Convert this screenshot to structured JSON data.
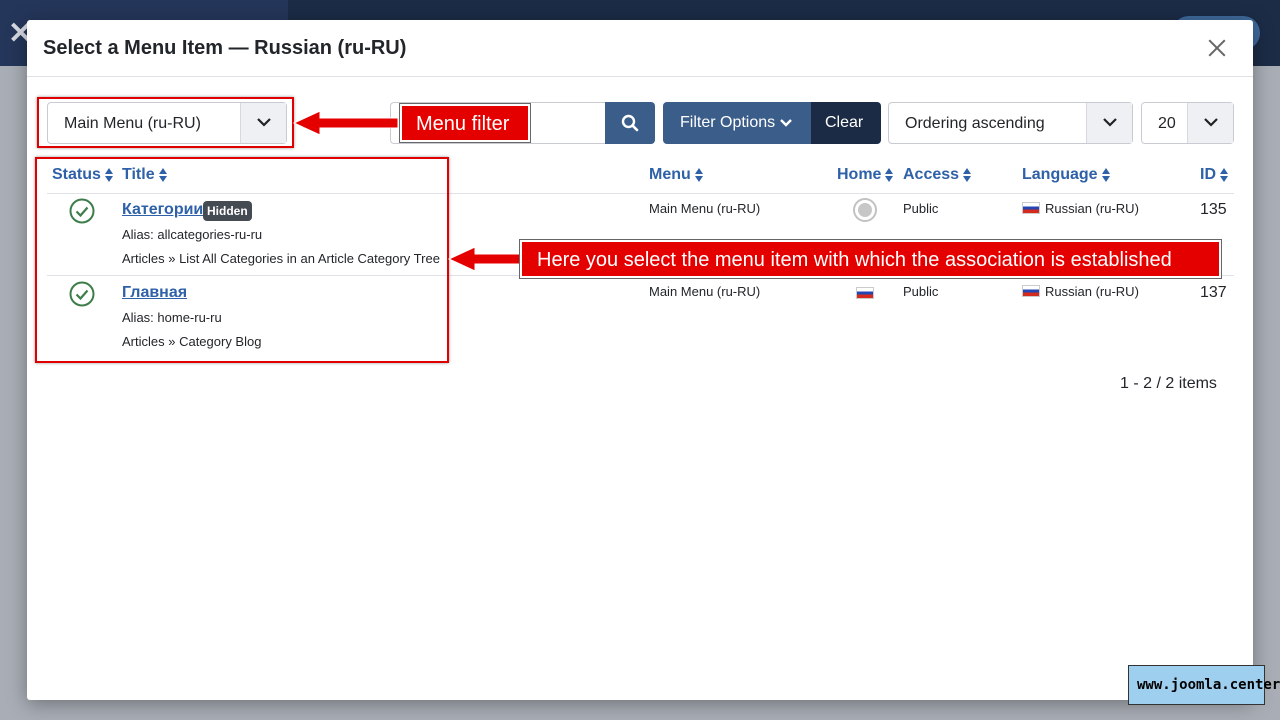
{
  "modal": {
    "title": "Select a Menu Item — Russian (ru-RU)"
  },
  "toolbar": {
    "menu_filter_value": "Main Menu (ru-RU)",
    "search_placeholder": "",
    "filter_options_label": "Filter Options",
    "clear_label": "Clear",
    "ordering_value": "Ordering ascending",
    "limit_value": "20"
  },
  "table": {
    "columns": {
      "status": "Status",
      "title": "Title",
      "menu": "Menu",
      "home": "Home",
      "access": "Access",
      "language": "Language",
      "id": "ID"
    },
    "rows": [
      {
        "title": "Категории",
        "badge": "Hidden",
        "alias": "Alias: allcategories-ru-ru",
        "type": "Articles » List All Categories in an Article Category Tree",
        "menu": "Main Menu (ru-RU)",
        "home": "not-default",
        "access": "Public",
        "language": "Russian (ru-RU)",
        "id": "135"
      },
      {
        "title": "Главная",
        "badge": "",
        "alias": "Alias: home-ru-ru",
        "type": "Articles » Category Blog",
        "menu": "Main Menu (ru-RU)",
        "home": "default-flag",
        "access": "Public",
        "language": "Russian (ru-RU)",
        "id": "137"
      }
    ]
  },
  "pagination": {
    "info": "1 - 2 / 2 items"
  },
  "annotations": {
    "menu_filter": "Menu filter",
    "select_item": "Here you select the menu item with which the association is established"
  },
  "watermark": "www.joomla.center",
  "icons": {
    "status": "published-check-icon",
    "search": "search-icon",
    "close": "close-icon",
    "caret": "chevron-down-icon",
    "flag": "ru-flag-icon"
  },
  "colors": {
    "accent": "#2f61a8",
    "primary_button": "#3b5d8a",
    "dark_button": "#1b2b45",
    "published": "#3d7d4a",
    "annotation": "#e50000"
  }
}
